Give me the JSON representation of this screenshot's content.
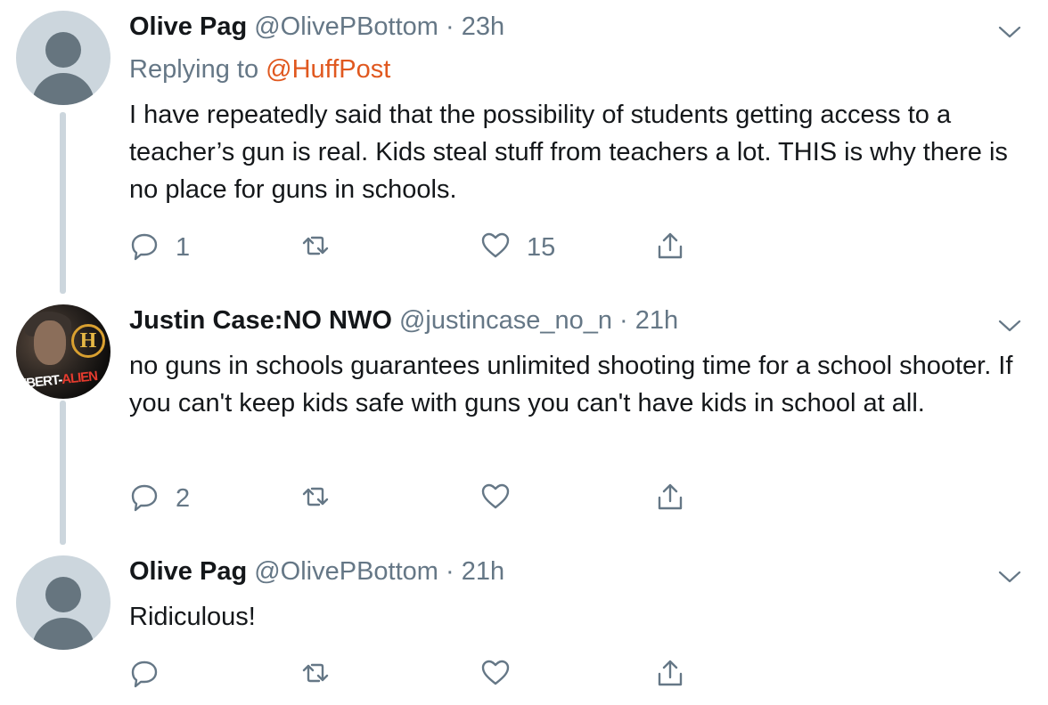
{
  "tweets": [
    {
      "name": "Olive Pag",
      "handle": "@OlivePBottom",
      "time": "23h",
      "replying_label": "Replying to",
      "replying_to": "@HuffPost",
      "text": "I have repeatedly said that the possibility of students getting access to a teacher’s gun is real. Kids steal stuff from teachers a lot. THIS is why there is no place for guns in schools.",
      "reply_count": "1",
      "retweet_count": "",
      "like_count": "15"
    },
    {
      "name": "Justin Case:NO NWO",
      "handle": "@justincase_no_n",
      "time": "21h",
      "avatar_text_left": "LIBERT",
      "avatar_text_right": "ALIEN",
      "avatar_logo": "H",
      "text": "no guns in schools guarantees unlimited shooting time for a school shooter. If you can't keep kids safe with guns you can't have kids in school at all.",
      "reply_count": "2",
      "retweet_count": "",
      "like_count": ""
    },
    {
      "name": "Olive Pag",
      "handle": "@OlivePBottom",
      "time": "21h",
      "text": "Ridiculous!",
      "reply_count": "",
      "retweet_count": "",
      "like_count": ""
    }
  ],
  "separator": " · ",
  "icons": {
    "reply": "reply-icon",
    "retweet": "retweet-icon",
    "like": "heart-icon",
    "share": "share-icon",
    "menu": "chevron-down-icon"
  },
  "colors": {
    "text": "#14171a",
    "muted": "#657786",
    "mention": "#e0581f",
    "thread_line": "#ccd6dd"
  }
}
